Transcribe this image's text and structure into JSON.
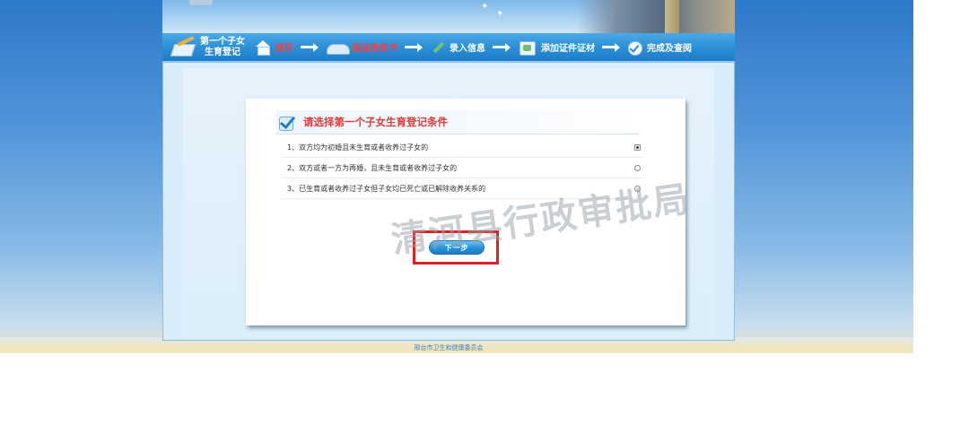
{
  "nav": {
    "title_line1": "第一个子女",
    "title_line2": "生育登记",
    "steps": [
      {
        "label": "首页",
        "icon": "home-icon"
      },
      {
        "label": "阅读告知书",
        "icon": "book-icon"
      },
      {
        "label": "录入信息",
        "icon": "pen-icon"
      },
      {
        "label": "添加证件证材",
        "icon": "document-icon"
      },
      {
        "label": "完成及查阅",
        "icon": "check-circle-icon"
      }
    ]
  },
  "card": {
    "title": "请选择第一个子女生育登记条件",
    "options": [
      {
        "label": "1、双方均为初婚且未生育或者收养过子女的",
        "checked": true
      },
      {
        "label": "2、双方或者一方为再婚，且未生育或者收养过子女的",
        "checked": false
      },
      {
        "label": "3、已生育或者收养过子女但子女均已死亡或已解除收养关系的",
        "checked": false
      }
    ],
    "next_label": "下一步"
  },
  "watermark": "清河县行政审批局",
  "footer": "邢台市卫生和健康委员会",
  "colors": {
    "nav_blue": "#2a8ed6",
    "title_red": "#e03a3a",
    "highlight_red": "#e02020",
    "button_blue": "#2b95d8"
  }
}
